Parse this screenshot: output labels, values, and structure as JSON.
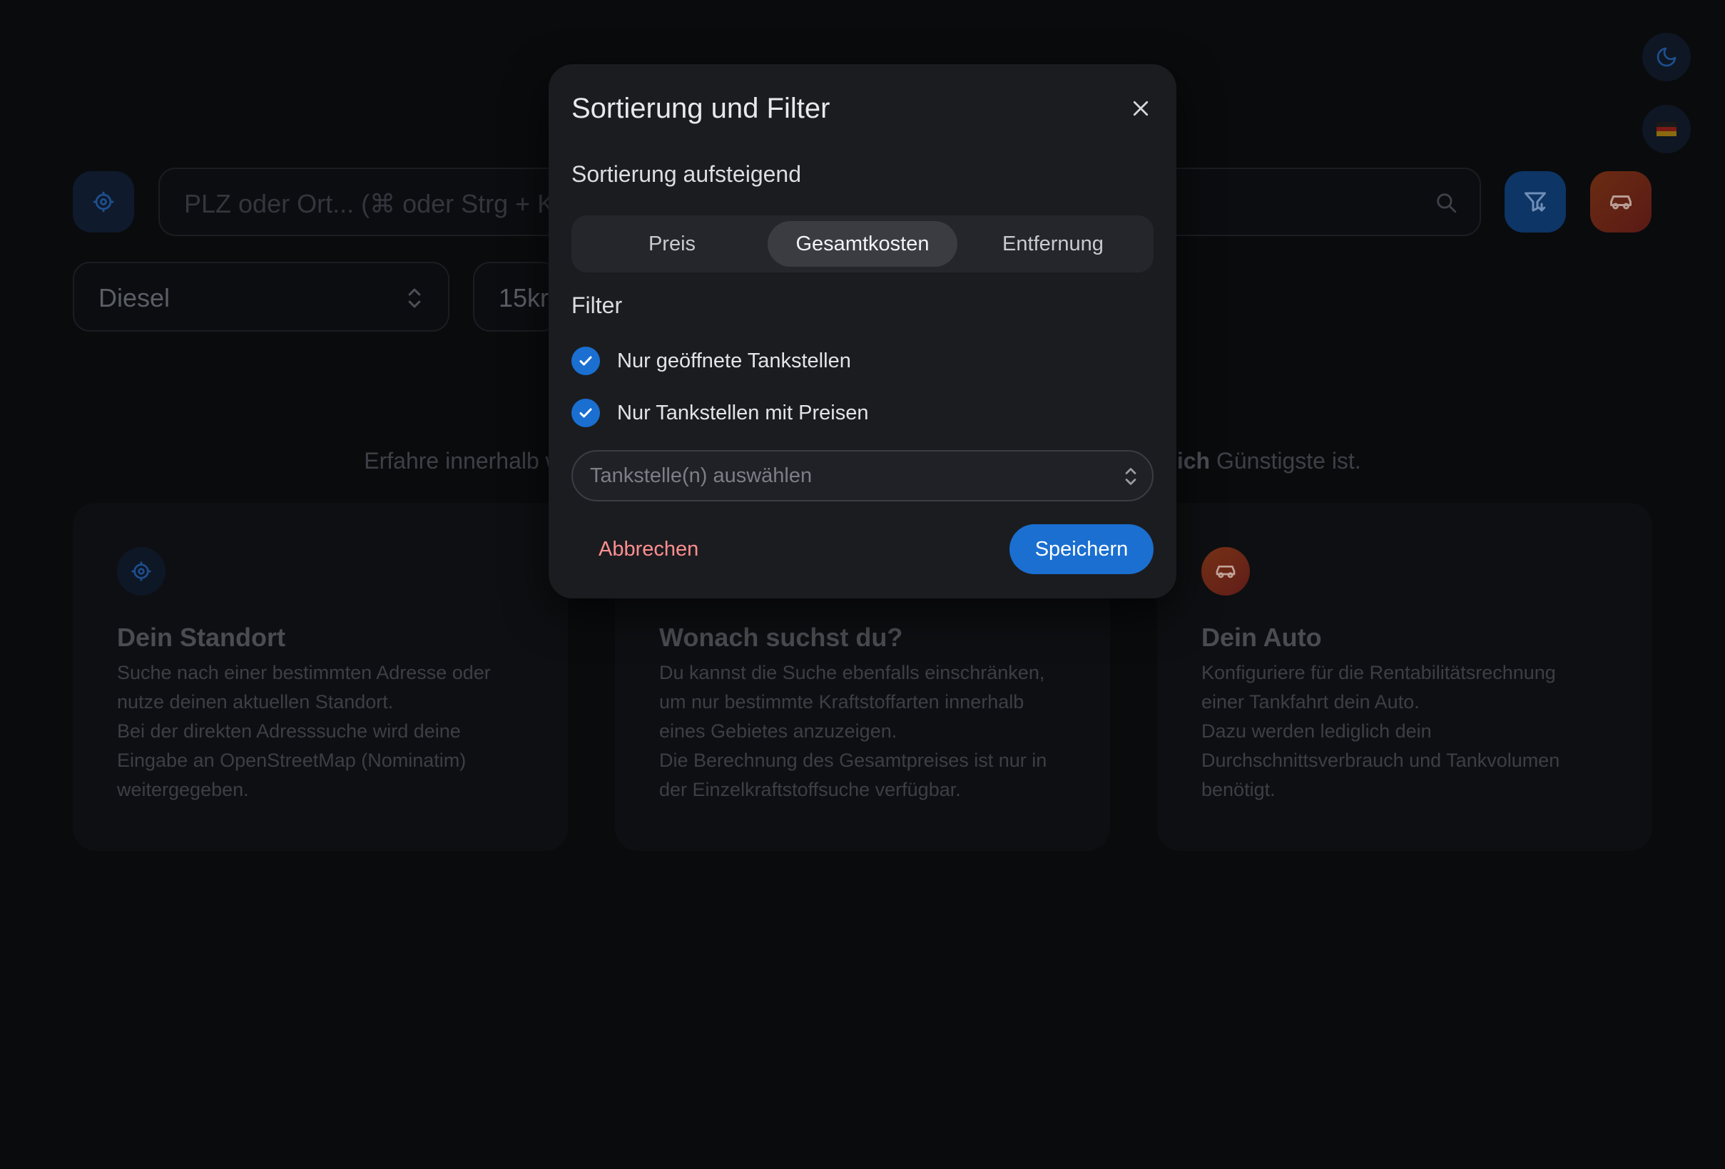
{
  "background": {
    "search": {
      "placeholder": "PLZ oder Ort... (⌘ oder Strg + K"
    },
    "fuel_select": {
      "value": "Diesel"
    },
    "radius_select": {
      "value": "15kr"
    },
    "tagline": {
      "left": "Erfahre innerhalb w",
      "bold": "tlich",
      "right": " Günstigste ist."
    },
    "cards": [
      {
        "title": "Dein Standort",
        "text": "Suche nach einer bestimmten Adresse oder nutze deinen aktuellen Standort.\nBei der direkten Adresssuche wird deine Eingabe an OpenStreetMap (Nominatim) weitergegeben.",
        "icon": "locate-icon"
      },
      {
        "title": "Wonach suchst du?",
        "text": "Du kannst die Suche ebenfalls einschränken, um nur bestimmte Kraftstoffarten innerhalb eines Gebietes anzuzeigen.\nDie Berechnung des Gesamtpreises ist nur in der Einzelkraftstoffsuche verfügbar.",
        "icon": "none"
      },
      {
        "title": "Dein Auto",
        "text": "Konfiguriere für die Rentabilitätsrechnung einer Tankfahrt dein Auto.\nDazu werden lediglich dein Durchschnittsverbrauch und Tankvolumen benötigt.",
        "icon": "car-icon"
      }
    ],
    "icons": {
      "theme": "moon-icon",
      "language": "german-flag-icon",
      "filter": "filter-icon",
      "car": "car-icon",
      "locate": "locate-icon",
      "search": "search-icon"
    },
    "colors": {
      "primary": "#1a6fd1",
      "car_gradient_from": "#e0571f",
      "car_gradient_to": "#b3261e"
    }
  },
  "modal": {
    "title": "Sortierung und Filter",
    "sort_label": "Sortierung aufsteigend",
    "sort_options": [
      "Preis",
      "Gesamtkosten",
      "Entfernung"
    ],
    "sort_selected": "Gesamtkosten",
    "filter_label": "Filter",
    "filters": [
      {
        "label": "Nur geöffnete Tankstellen",
        "checked": true
      },
      {
        "label": "Nur Tankstellen mit Preisen",
        "checked": true
      }
    ],
    "station_select": {
      "placeholder": "Tankstelle(n) auswählen"
    },
    "cancel_label": "Abbrechen",
    "save_label": "Speichern"
  }
}
